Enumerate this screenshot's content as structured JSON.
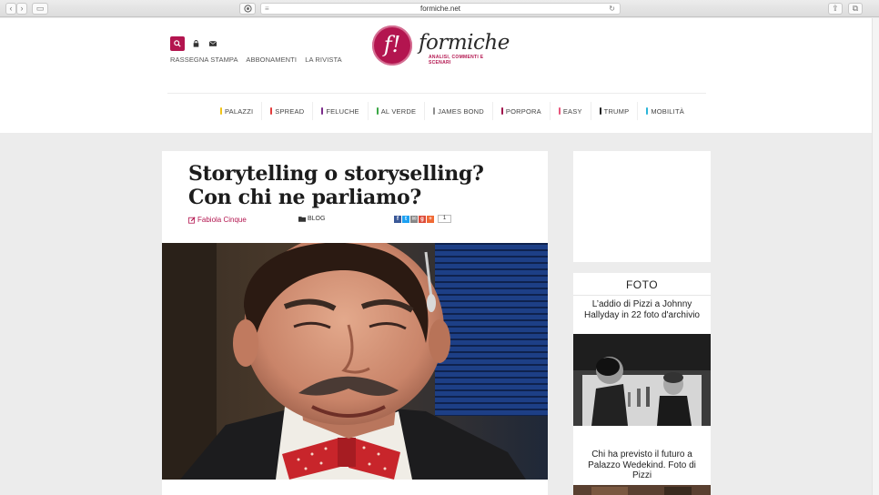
{
  "browser": {
    "url": "formiche.net",
    "back_glyph": "‹",
    "forward_glyph": "›",
    "sidebar_glyph": "▭",
    "share_glyph": "⇪",
    "tabs_glyph": "⧉"
  },
  "header": {
    "top_links": [
      "RASSEGNA STAMPA",
      "ABBONAMENTI",
      "LA RIVISTA"
    ],
    "logo": {
      "mark": "f!",
      "word": "formiche",
      "tagline": "ANALISI, COMMENTI E SCENARI"
    },
    "nav": [
      {
        "label": "PALAZZI",
        "color": "#f0c419"
      },
      {
        "label": "SPREAD",
        "color": "#e23c3c"
      },
      {
        "label": "FELUCHE",
        "color": "#7b2c8b"
      },
      {
        "label": "AL VERDE",
        "color": "#3aa845"
      },
      {
        "label": "JAMES BOND",
        "color": "#8d8d8d"
      },
      {
        "label": "PORPORA",
        "color": "#a0144c"
      },
      {
        "label": "EASY",
        "color": "#e8557b"
      },
      {
        "label": "TRUMP",
        "color": "#222222"
      },
      {
        "label": "MOBILITÀ",
        "color": "#2bb5d8"
      }
    ]
  },
  "article": {
    "title": "Storytelling o storyselling? Con chi ne parliamo?",
    "author": "Fabiola Cinque",
    "category": "BLOG",
    "share_count": "1",
    "share_buttons": [
      {
        "name": "facebook",
        "glyph": "f",
        "color": "#3b5998"
      },
      {
        "name": "twitter",
        "glyph": "t",
        "color": "#1da1f2"
      },
      {
        "name": "email",
        "glyph": "✉",
        "color": "#888888"
      },
      {
        "name": "google-plus",
        "glyph": "g",
        "color": "#dd4b39"
      },
      {
        "name": "more",
        "glyph": "+",
        "color": "#f06a35"
      }
    ]
  },
  "sidebar": {
    "foto_heading": "FOTO",
    "items": [
      {
        "title": "L’addio di Pizzi a Johnny Hallyday in 22 foto d'archivio"
      },
      {
        "title": "Chi ha previsto il futuro a Palazzo Wedekind. Foto di Pizzi"
      }
    ]
  },
  "colors": {
    "brand": "#b3154f"
  }
}
